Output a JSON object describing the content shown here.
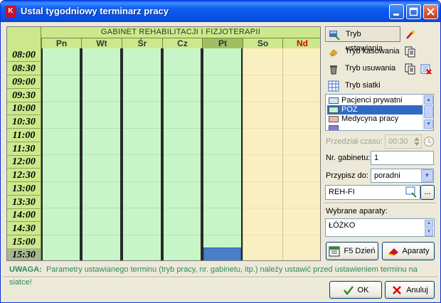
{
  "window": {
    "title": "Ustal tygodniowy terminarz pracy",
    "app_icon_letter": "K",
    "colors": {
      "titlebar": "#0a5ae8",
      "work_day": "#c8f5c8",
      "weekend": "#faefc0",
      "header": "#cde88c",
      "selected_cell": "#4a7ec8",
      "sunday_label": "#e00000"
    }
  },
  "schedule": {
    "title": "GABINET REHABILITACJI I FIZJOTERAPII",
    "days": [
      "Pn",
      "Wt",
      "Śr",
      "Cz",
      "Pt",
      "So",
      "Nd"
    ],
    "selected_day": "Pt",
    "selected_time": "15:30",
    "times": [
      "08:00",
      "08:30",
      "09:00",
      "09:30",
      "10:00",
      "10:30",
      "11:00",
      "11:30",
      "12:00",
      "12:30",
      "13:00",
      "13:30",
      "14:00",
      "14:30",
      "15:00",
      "15:30"
    ]
  },
  "modes": {
    "settings": "Tryb ustawiania",
    "delete": "Tryb kasowania",
    "remove": "Tryb usuwania",
    "grid": "Tryb siatki"
  },
  "patient_types": [
    {
      "label": "Pacjenci prywatni",
      "color": "#cfe8fa"
    },
    {
      "label": "POZ",
      "color": "#bdf5bd"
    },
    {
      "label": "Medycyna pracy",
      "color": "#f7b6a4"
    },
    {
      "label": "",
      "color": "#8a7ad8"
    }
  ],
  "selected_patient_type": "POZ",
  "form": {
    "interval_label": "Przedział czasu:",
    "interval_value": "00:30",
    "room_label": "Nr. gabinetu:",
    "room_value": "1",
    "assign_label": "Przypisz do:",
    "assign_value": "poradni",
    "clinic_value": "REH-FI",
    "clinic_button_label": "...",
    "devices_label": "Wybrane aparaty:",
    "devices_value": "ŁÓŻKO"
  },
  "buttons": {
    "f5_day": "F5 Dzień",
    "devices": "Aparaty",
    "ok": "OK",
    "cancel": "Anuluj"
  },
  "warning": {
    "key": "UWAGA:",
    "message": "Parametry ustawianego terminu (tryb pracy, nr. gabinetu, itp.) należy ustawić przed ustawieniem terminu na siatce!"
  }
}
